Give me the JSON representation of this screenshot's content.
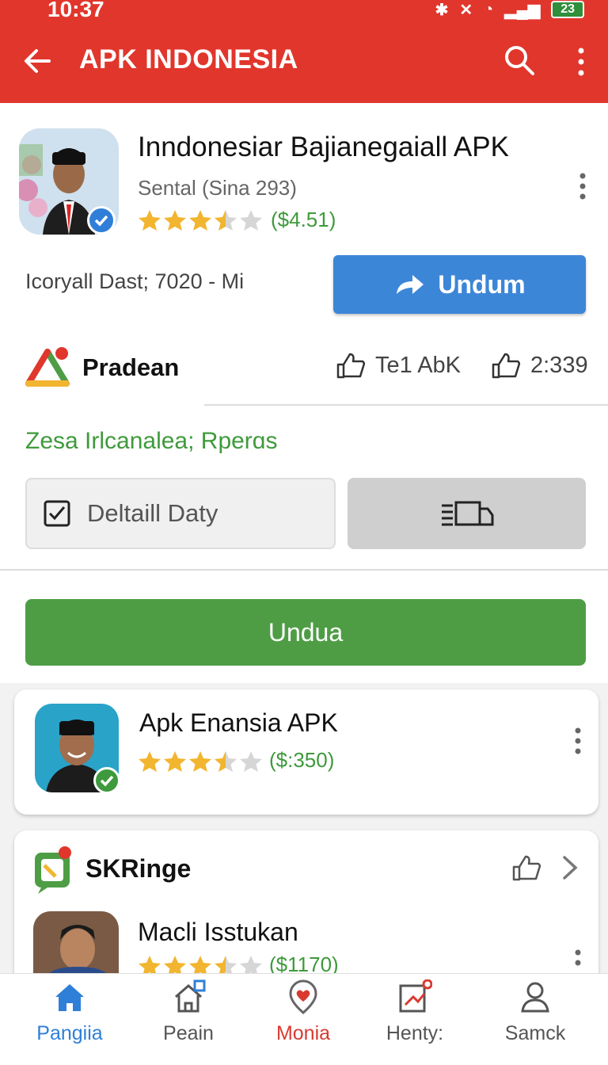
{
  "status": {
    "time": "10:37",
    "battery": "23"
  },
  "appbar": {
    "title": "APK INDONESIA"
  },
  "app": {
    "title": "Inndonesiar Bajianegaiall APK",
    "subtitle": "Sental (Sina 293)",
    "rating_value": 3.5,
    "rating_text": "($4.51)",
    "meta": "Icoryall Dast; 7020 - Mi",
    "install_label": "Undum"
  },
  "developer": {
    "name": "Pradean",
    "tag1": "Te1 AbK",
    "tag2": "2:339"
  },
  "caption": "Zesa Irlcanalea; Rperɑs",
  "detail_button": "Deltaill Daty",
  "download_button": "Undua",
  "cards": {
    "card1": {
      "title": "Apk Enansia APK",
      "rating_value": 3.5,
      "rating_text": "($:350)"
    },
    "card2": {
      "section": "SKRinge",
      "title": "Macli Isstukan",
      "rating_value": 3.5,
      "rating_text": "($1170)"
    }
  },
  "nav": {
    "items": [
      {
        "label": "Pangiia",
        "icon": "home-icon",
        "color": "#2f7fd8"
      },
      {
        "label": "Peain",
        "icon": "house-outline-icon",
        "color": "#555555"
      },
      {
        "label": "Monia",
        "icon": "heart-location-icon",
        "color": "#d93a30"
      },
      {
        "label": "Henty:",
        "icon": "edit-chart-icon",
        "color": "#555555"
      },
      {
        "label": "Samck",
        "icon": "person-icon",
        "color": "#555555"
      }
    ]
  },
  "colors": {
    "accent": "#e1362c",
    "primary": "#3c86d8",
    "green": "#4e9d45",
    "star": "#f2b530"
  }
}
